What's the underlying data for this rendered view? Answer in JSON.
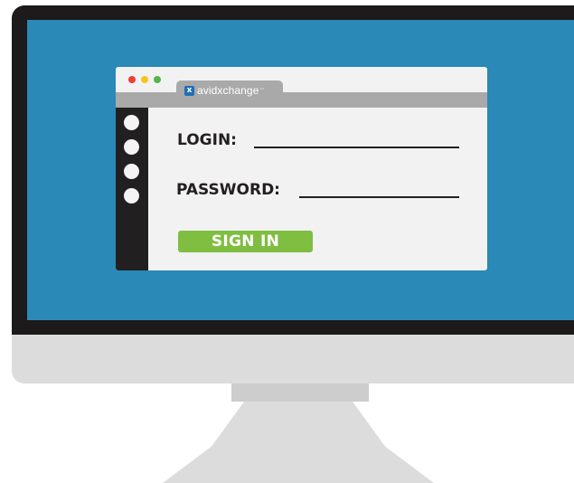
{
  "browser": {
    "tab_logo_mark": "x",
    "tab_logo_text": "avidxchange",
    "tab_logo_tm": "™"
  },
  "login_form": {
    "login_label": "LOGIN:",
    "password_label": "PASSWORD:",
    "signin_label": "SIGN IN"
  },
  "colors": {
    "screen": "#2a89b6",
    "bezel": "#1c1a1b",
    "signin_button": "#7fbe41",
    "window_dot_red": "#ef3e36",
    "window_dot_yellow": "#f6c51b",
    "window_dot_green": "#55b549"
  }
}
